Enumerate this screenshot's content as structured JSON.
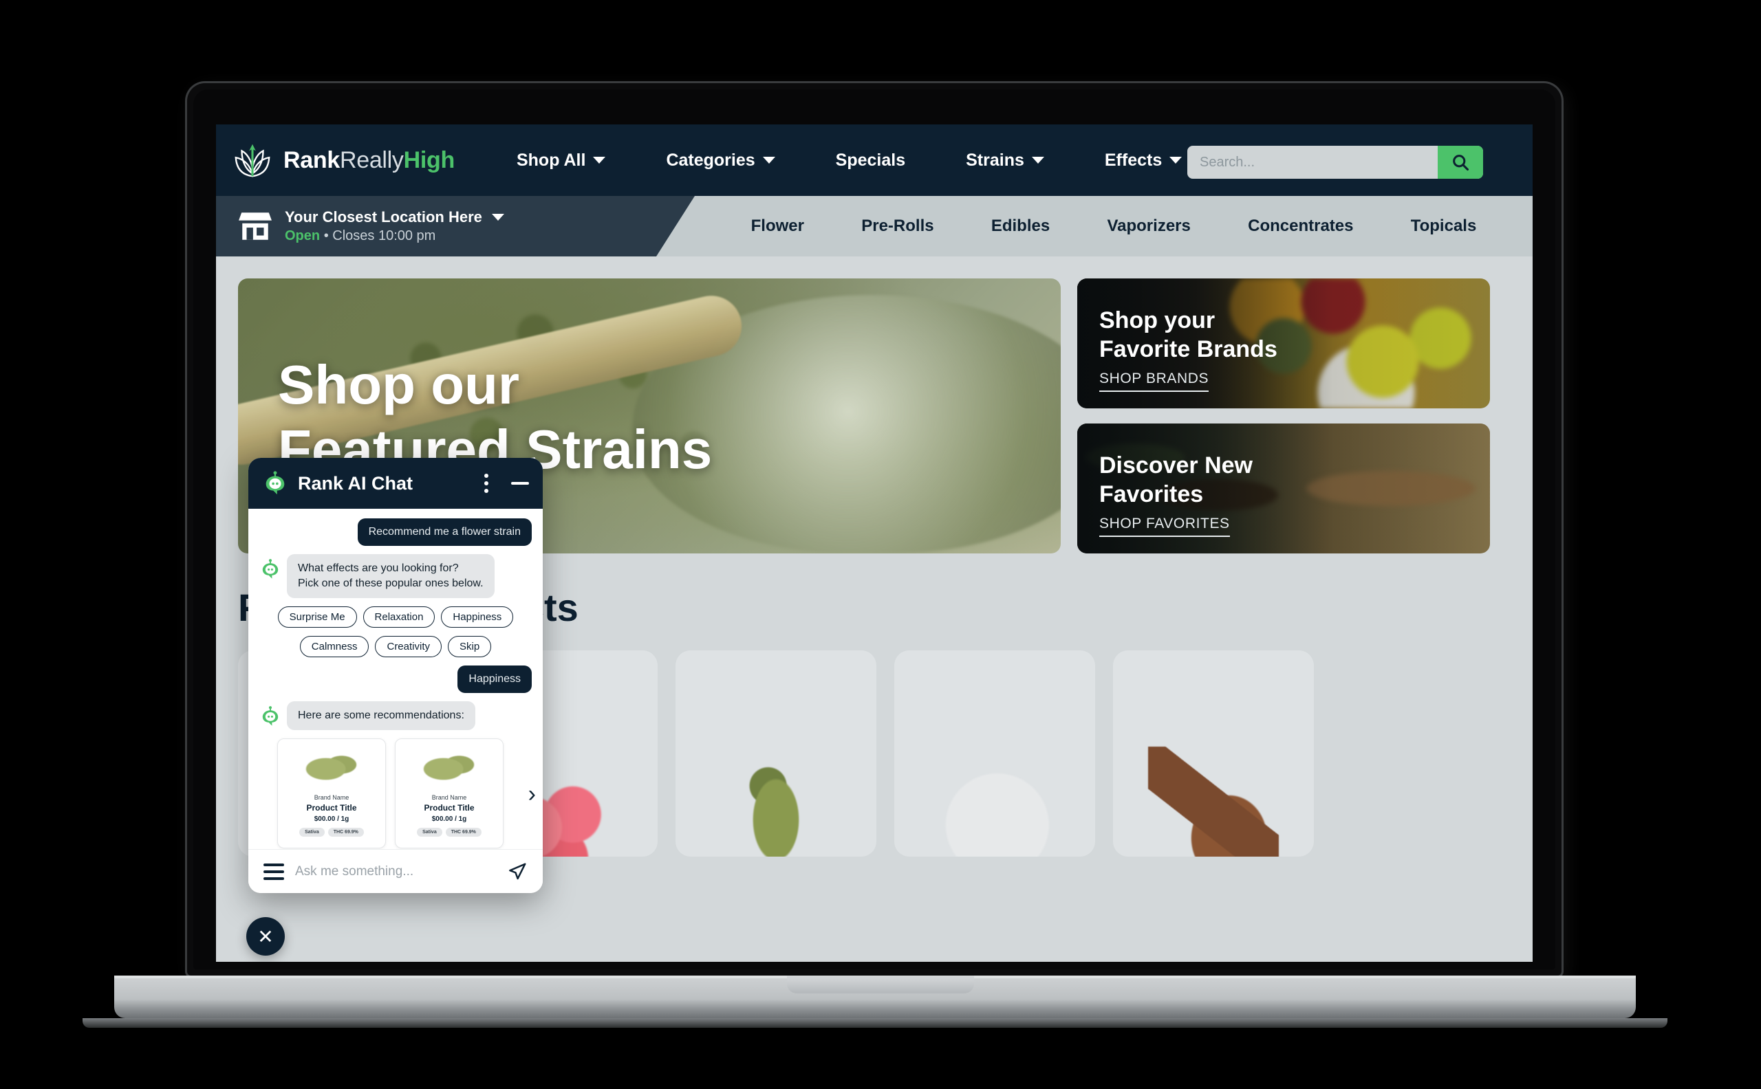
{
  "brand": {
    "part1": "Rank",
    "part2": "Really",
    "part3": "High",
    "logo_icon": "cannabis-leaf-icon"
  },
  "topnav": {
    "links": [
      {
        "label": "Shop All",
        "has_caret": true
      },
      {
        "label": "Categories",
        "has_caret": true
      },
      {
        "label": "Specials",
        "has_caret": false
      },
      {
        "label": "Strains",
        "has_caret": true
      },
      {
        "label": "Effects",
        "has_caret": true
      }
    ],
    "search": {
      "placeholder": "Search...",
      "value": "",
      "button_icon": "search-icon"
    }
  },
  "locationbar": {
    "icon": "storefront-icon",
    "title": "Your Closest Location Here",
    "status": "Open",
    "separator": "•",
    "hours": "Closes 10:00 pm"
  },
  "categories": [
    "Flower",
    "Pre-Rolls",
    "Edibles",
    "Vaporizers",
    "Concentrates",
    "Topicals"
  ],
  "hero": {
    "title_line1": "Shop our",
    "title_line2": "Featured Strains"
  },
  "promos": [
    {
      "title_line1": "Shop your",
      "title_line2": "Favorite Brands",
      "cta": "SHOP BRANDS"
    },
    {
      "title_line1": "Discover New",
      "title_line2": "Favorites",
      "cta": "SHOP FAVORITES"
    }
  ],
  "featured": {
    "heading": "Featured Products",
    "cards": [
      {
        "thumb": "gummy-thumb"
      },
      {
        "thumb": "flower-bud-thumb"
      },
      {
        "thumb": "concentrate-thumb"
      },
      {
        "thumb": "chocolate-thumb"
      }
    ]
  },
  "chat": {
    "title": "Rank AI Chat",
    "avatar_icon": "robot-avatar-icon",
    "menu_icon": "kebab-menu-icon",
    "minimize_icon": "minimize-icon",
    "messages": [
      {
        "from": "user",
        "text": "Recommend me a flower strain"
      },
      {
        "from": "bot",
        "text": "What effects are you looking for?\nPick one of these popular ones below."
      }
    ],
    "chips_row1": [
      "Surprise Me",
      "Relaxation",
      "Happiness"
    ],
    "chips_row2": [
      "Calmness",
      "Creativity",
      "Skip"
    ],
    "reply": "Happiness",
    "recommendations_text": "Here are some recommendations:",
    "products": [
      {
        "brand": "Brand Name",
        "title": "Product Title",
        "price": "$00.00 / 1g",
        "badge1": "Sativa",
        "badge2": "THC 69.9%"
      },
      {
        "brand": "Brand Name",
        "title": "Product Title",
        "price": "$00.00 / 1g",
        "badge1": "Sativa",
        "badge2": "THC 69.9%"
      }
    ],
    "carousel_next_icon": "chevron-right-icon",
    "input": {
      "placeholder": "Ask me something...",
      "value": "",
      "menu_icon": "hamburger-icon",
      "send_icon": "send-icon"
    },
    "close_icon": "close-icon"
  },
  "colors": {
    "navy": "#0d2031",
    "slate": "#2b3b49",
    "green": "#4cc26a",
    "page_bg": "#d3d8da",
    "subbar_bg": "#c3cbcd"
  }
}
